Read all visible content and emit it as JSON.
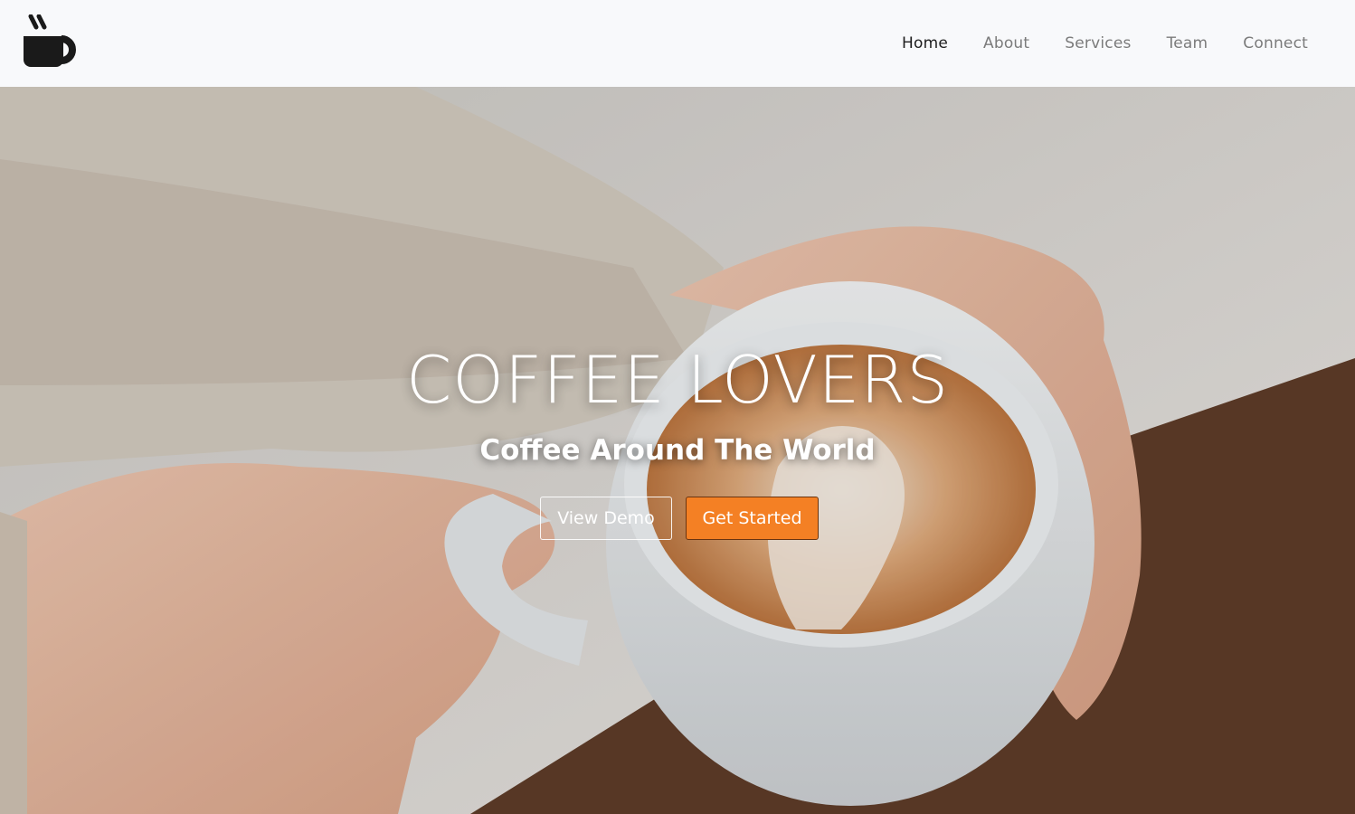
{
  "brand": {
    "logo_icon": "coffee-cup-icon"
  },
  "nav": {
    "items": [
      {
        "label": "Home",
        "active": true
      },
      {
        "label": "About",
        "active": false
      },
      {
        "label": "Services",
        "active": false
      },
      {
        "label": "Team",
        "active": false
      },
      {
        "label": "Connect",
        "active": false
      }
    ]
  },
  "hero": {
    "title": "COFFEE LOVERS",
    "subtitle": "Coffee Around The World",
    "primary_button": "Get Started",
    "secondary_button": "View Demo",
    "accent_color": "#f48024"
  }
}
